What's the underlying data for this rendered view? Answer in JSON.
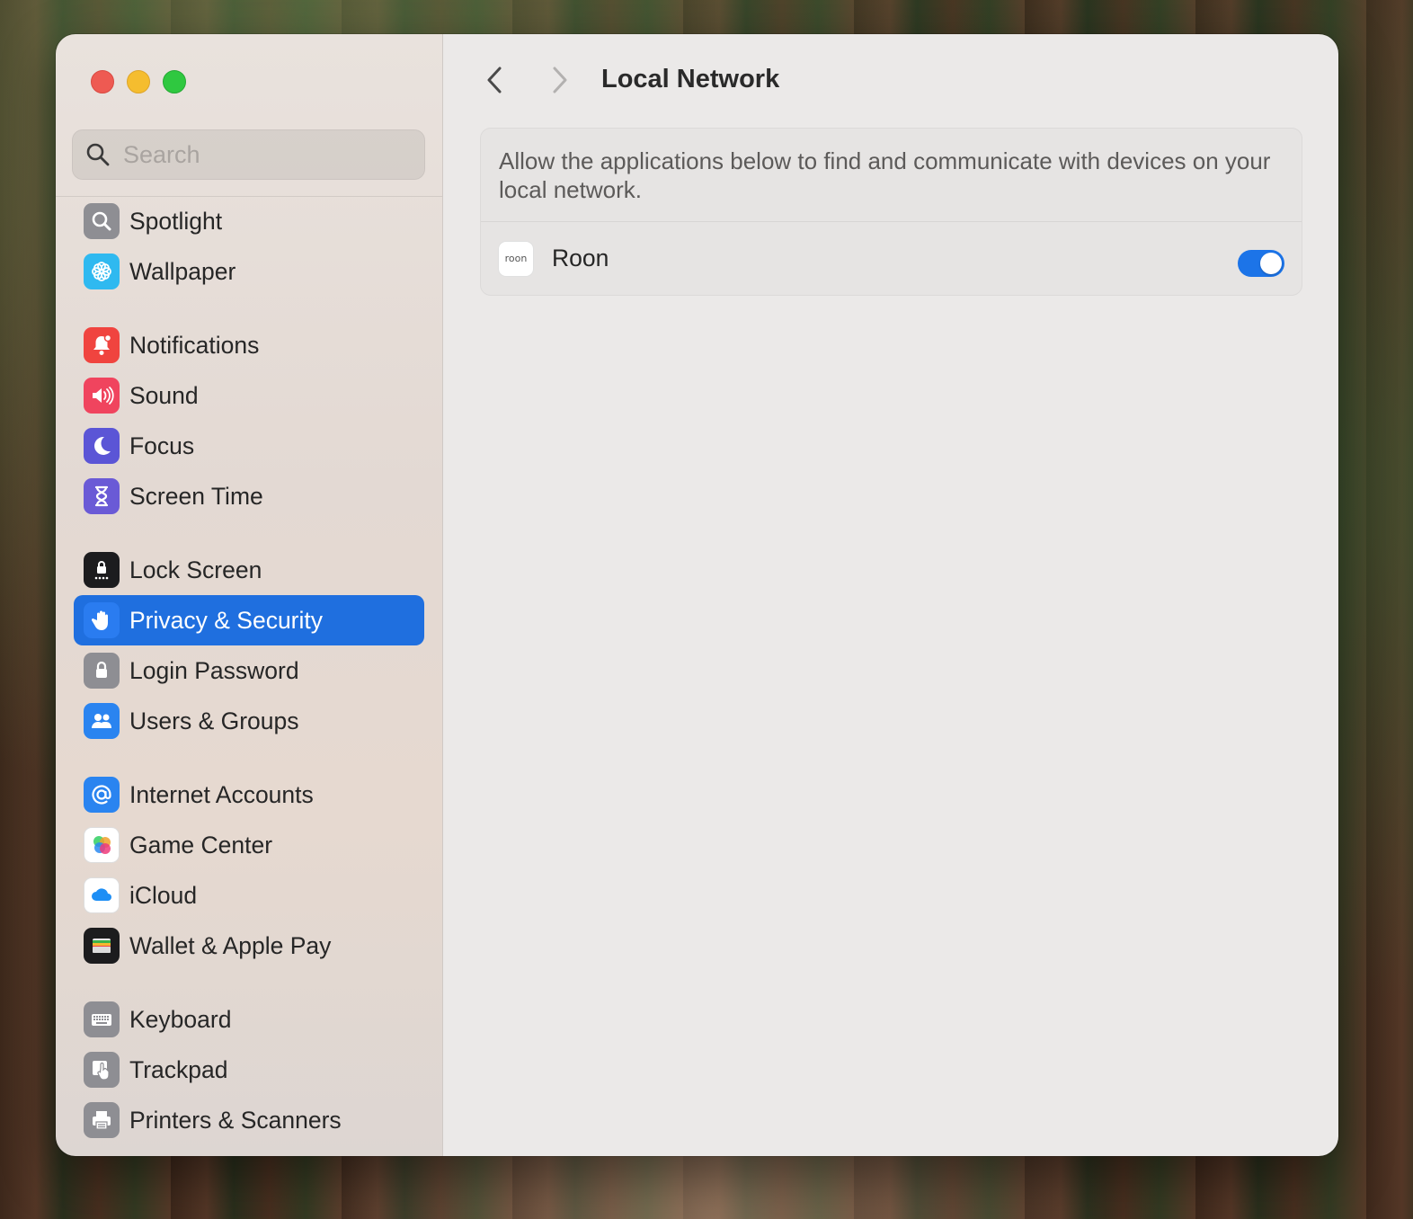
{
  "window": {
    "controls": [
      "close",
      "minimize",
      "zoom"
    ]
  },
  "search": {
    "placeholder": "Search"
  },
  "sidebar": {
    "items": [
      {
        "label": "Spotlight",
        "icon": "spotlight-icon",
        "color": "#8e8e93"
      },
      {
        "label": "Wallpaper",
        "icon": "wallpaper-icon",
        "color": "#2fb9f0"
      },
      {
        "label": "Notifications",
        "icon": "notifications-icon",
        "color": "#f0443f"
      },
      {
        "label": "Sound",
        "icon": "sound-icon",
        "color": "#f0445e"
      },
      {
        "label": "Focus",
        "icon": "focus-icon",
        "color": "#5b55d6"
      },
      {
        "label": "Screen Time",
        "icon": "screen-time-icon",
        "color": "#6a5ad6"
      },
      {
        "label": "Lock Screen",
        "icon": "lock-screen-icon",
        "color": "#1c1c1e"
      },
      {
        "label": "Privacy & Security",
        "icon": "privacy-hand-icon",
        "color": "#2a7cf0",
        "selected": true
      },
      {
        "label": "Login Password",
        "icon": "login-password-icon",
        "color": "#8e8e93"
      },
      {
        "label": "Users & Groups",
        "icon": "users-groups-icon",
        "color": "#2a84f0"
      },
      {
        "label": "Internet Accounts",
        "icon": "internet-accounts-icon",
        "color": "#2a84f0"
      },
      {
        "label": "Game Center",
        "icon": "game-center-icon",
        "color": "#ffffff"
      },
      {
        "label": "iCloud",
        "icon": "icloud-icon",
        "color": "#ffffff"
      },
      {
        "label": "Wallet & Apple Pay",
        "icon": "wallet-icon",
        "color": "#1c1c1e"
      },
      {
        "label": "Keyboard",
        "icon": "keyboard-icon",
        "color": "#8e8e93"
      },
      {
        "label": "Trackpad",
        "icon": "trackpad-icon",
        "color": "#8e8e93"
      },
      {
        "label": "Printers & Scanners",
        "icon": "printers-icon",
        "color": "#8e8e93"
      }
    ]
  },
  "main": {
    "title": "Local Network",
    "description": "Allow the applications below to find and communicate with devices on your local network.",
    "apps": [
      {
        "name": "Roon",
        "icon_text": "roon",
        "enabled": true
      }
    ]
  },
  "colors": {
    "accent": "#1f6fdf",
    "toggle_on": "#1c74e8"
  }
}
